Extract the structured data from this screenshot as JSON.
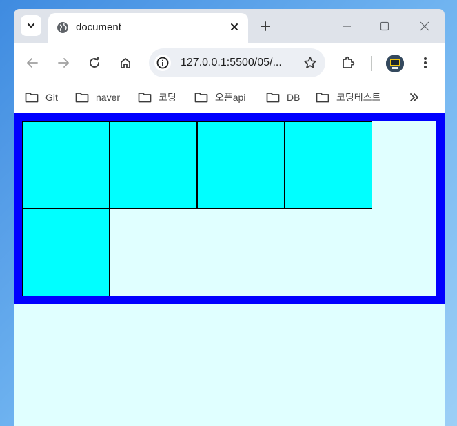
{
  "browser": {
    "tab_title": "document",
    "url": "127.0.0.1:5500/05/...",
    "bookmarks": [
      {
        "label": "Git"
      },
      {
        "label": "naver"
      },
      {
        "label": "코딩"
      },
      {
        "label": "오픈api"
      },
      {
        "label": "DB"
      },
      {
        "label": "코딩테스트"
      }
    ]
  },
  "page": {
    "container_border_color": "#0000ff",
    "background_color": "#e0ffff",
    "box_color": "#00ffff",
    "box_count": 5
  }
}
